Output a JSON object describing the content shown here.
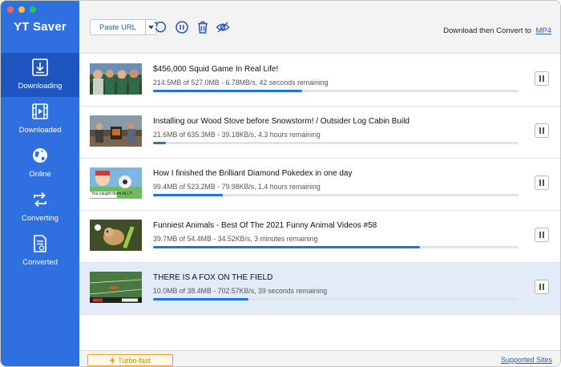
{
  "app": {
    "title": "YT Saver"
  },
  "sidebar": {
    "items": [
      {
        "label": "Downloading",
        "icon": "download-icon",
        "active": true
      },
      {
        "label": "Downloaded",
        "icon": "film-icon",
        "active": false
      },
      {
        "label": "Online",
        "icon": "globe-icon",
        "active": false
      },
      {
        "label": "Converting",
        "icon": "convert-arrows-icon",
        "active": false
      },
      {
        "label": "Converted",
        "icon": "converted-file-icon",
        "active": false
      }
    ]
  },
  "toolbar": {
    "paste_label": "Paste URL",
    "convert_label": "Download then Convert to",
    "convert_format": "MP4",
    "icons": [
      "refresh-icon",
      "pause-all-icon",
      "trash-icon",
      "hide-icon"
    ]
  },
  "downloads": [
    {
      "title": "$456,000 Squid Game In Real Life!",
      "status": "214.5MB of 527.0MB - 6.78MB/s, 42 seconds remaining",
      "progress": 0.407
    },
    {
      "title": "Installing our Wood Stove before Snowstorm! / Outsider Log Cabin Build",
      "status": "21.6MB of 635.3MB - 39.18KB/s, 4.3 hours remaining",
      "progress": 0.034
    },
    {
      "title": "How I finished the Brilliant Diamond Pokedex in one day",
      "status": "99.4MB of 523.2MB - 79.98KB/s, 1.4 hours remaining",
      "progress": 0.19
    },
    {
      "title": "Funniest Animals - Best Of The 2021 Funny Animal Videos #58",
      "status": "39.7MB of 54.4MB - 34.52KB/s, 3 minutes remaining",
      "progress": 0.73
    },
    {
      "title": "THERE IS A FOX ON THE FIELD",
      "status": "10.0MB of 38.4MB - 702.57KB/s, 39 seconds remaining",
      "progress": 0.26,
      "selected": true
    }
  ],
  "thumb_captions": {
    "pokedex": "You caught them ALL?!"
  },
  "footer": {
    "turbo_label": "Turbo-fast",
    "supported_label": "Supported Sites"
  },
  "colors": {
    "sidebar": "#2f6fe0",
    "sidebar_active": "#1f55c0",
    "progress": "#1d72ee",
    "selected_row": "#e4ebf8",
    "turbo": "#e08a00"
  }
}
